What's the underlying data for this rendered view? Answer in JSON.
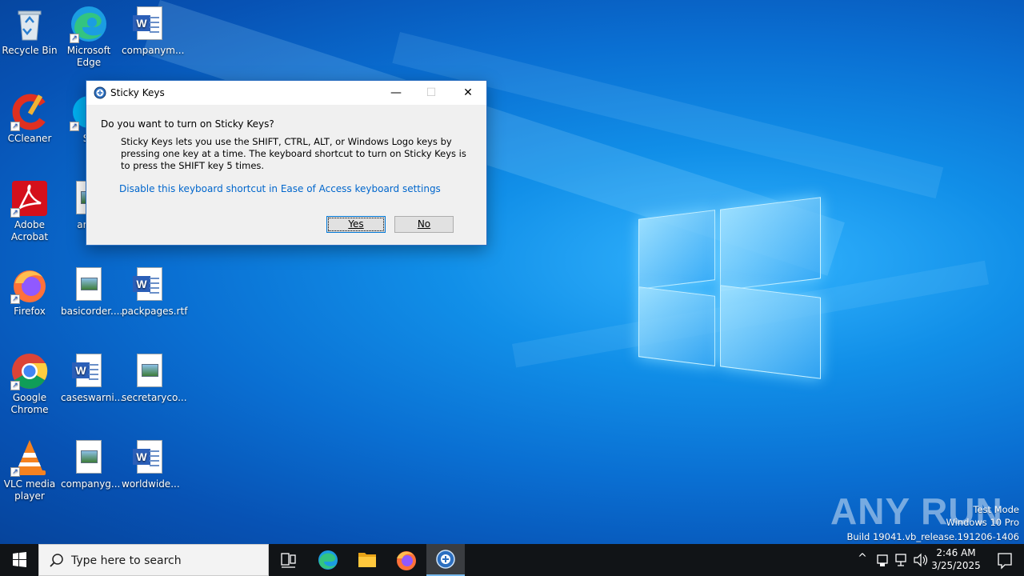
{
  "desktop": {
    "icons": [
      {
        "label": "Recycle Bin",
        "icon": "recycle-bin-icon"
      },
      {
        "label": "Microsoft Edge",
        "icon": "edge-icon"
      },
      {
        "label": "companym...",
        "icon": "word-document-icon"
      },
      {
        "label": "CCleaner",
        "icon": "ccleaner-icon"
      },
      {
        "label": "Sk",
        "icon": "skype-icon"
      },
      {
        "label": "Adobe Acrobat",
        "icon": "acrobat-icon"
      },
      {
        "label": "archi",
        "icon": "document-icon"
      },
      {
        "label": "Firefox",
        "icon": "firefox-icon"
      },
      {
        "label": "basicorder....",
        "icon": "image-document-icon"
      },
      {
        "label": "packpages.rtf",
        "icon": "word-document-icon"
      },
      {
        "label": "Google Chrome",
        "icon": "chrome-icon"
      },
      {
        "label": "caseswarni...",
        "icon": "word-document-icon"
      },
      {
        "label": "secretaryco...",
        "icon": "image-document-icon"
      },
      {
        "label": "VLC media player",
        "icon": "vlc-icon"
      },
      {
        "label": "companyg...",
        "icon": "image-document-icon"
      },
      {
        "label": "worldwide...",
        "icon": "word-document-icon"
      }
    ]
  },
  "dialog": {
    "title": "Sticky Keys",
    "question": "Do you want to turn on Sticky Keys?",
    "body": "Sticky Keys lets you use the SHIFT, CTRL, ALT, or Windows Logo keys by pressing one key at a time. The keyboard shortcut to turn on Sticky Keys is to press the SHIFT key 5 times.",
    "link": "Disable this keyboard shortcut in Ease of Access keyboard settings",
    "yes_label": "Yes",
    "no_label": "No",
    "minimize_glyph": "—",
    "maximize_glyph": "☐",
    "close_glyph": "✕"
  },
  "watermark": {
    "brand": "ANY RUN",
    "line1": "Test Mode",
    "line2": "Windows 10 Pro",
    "line3": "Build 19041.vb_release.191206-1406"
  },
  "taskbar": {
    "search_placeholder": "Type here to search",
    "clock_time": "2:46 AM",
    "clock_date": "3/25/2025",
    "tray_chevron": "^",
    "colors": {
      "background": "#111417",
      "accent": "#76b9ed"
    }
  }
}
